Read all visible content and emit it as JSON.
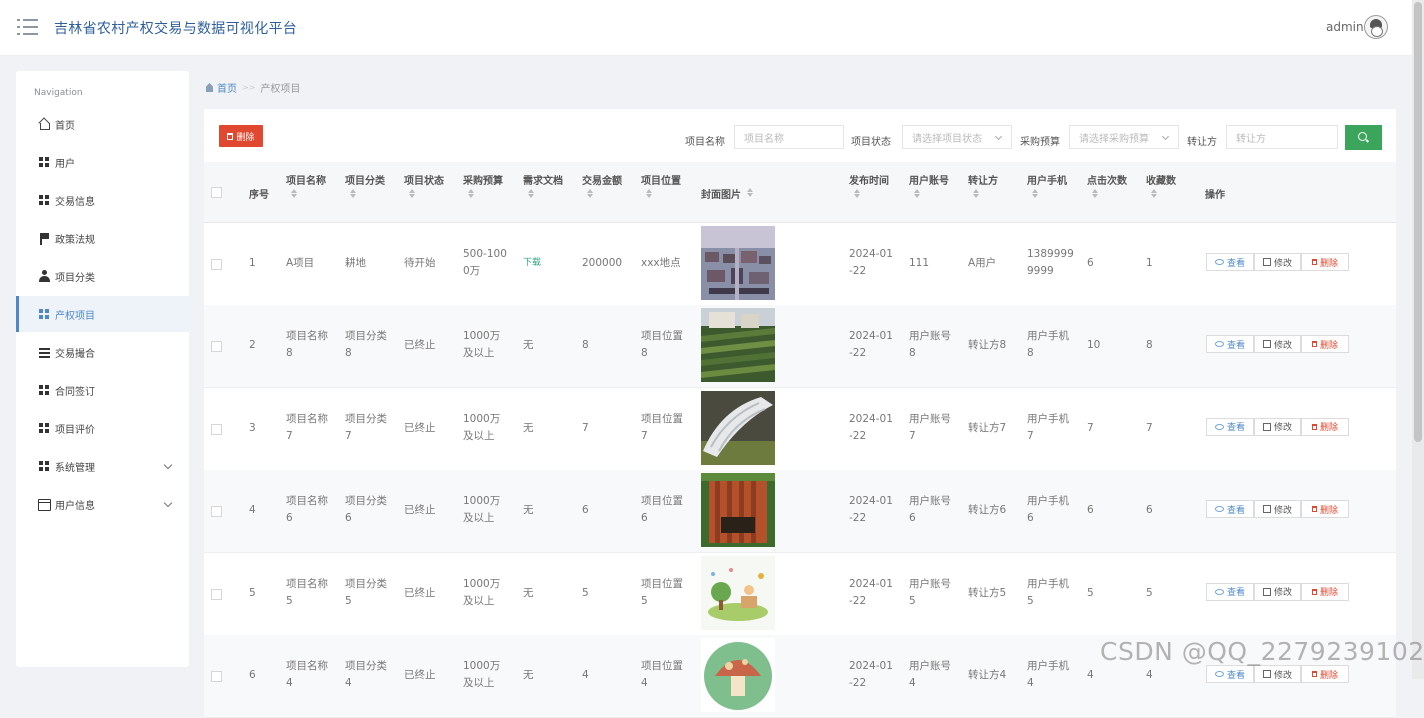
{
  "header": {
    "title": "吉林省农村产权交易与数据可视化平台",
    "user": "admin"
  },
  "sidebar": {
    "caption": "Navigation",
    "items": [
      {
        "label": "首页",
        "icon": "home-icon"
      },
      {
        "label": "用户",
        "icon": "grid-icon"
      },
      {
        "label": "交易信息",
        "icon": "grid-icon"
      },
      {
        "label": "政策法规",
        "icon": "flag-icon"
      },
      {
        "label": "项目分类",
        "icon": "user-icon"
      },
      {
        "label": "产权项目",
        "icon": "grid-icon",
        "active": true
      },
      {
        "label": "交易撮合",
        "icon": "list-icon"
      },
      {
        "label": "合同签订",
        "icon": "grid-icon"
      },
      {
        "label": "项目评价",
        "icon": "grid-icon"
      },
      {
        "label": "系统管理",
        "icon": "grid-icon",
        "expandable": true
      },
      {
        "label": "用户信息",
        "icon": "card-icon",
        "expandable": true
      }
    ]
  },
  "breadcrumb": {
    "home": "首页",
    "separator": ">>",
    "current": "产权项目"
  },
  "toolbar": {
    "delete_label": "删除",
    "filters": {
      "name_label": "项目名称",
      "name_placeholder": "项目名称",
      "status_label": "项目状态",
      "status_placeholder": "请选择项目状态",
      "budget_label": "采购预算",
      "budget_placeholder": "请选择采购预算",
      "transferor_label": "转让方",
      "transferor_placeholder": "转让方"
    }
  },
  "table": {
    "headers": {
      "index": "序号",
      "name": "项目名称",
      "category": "项目分类",
      "status": "项目状态",
      "budget": "采购预算",
      "doc": "需求文档",
      "amount": "交易金额",
      "location": "项目位置",
      "cover": "封面图片",
      "time": "发布时间",
      "account": "用户账号",
      "transferor": "转让方",
      "phone": "用户手机",
      "clicks": "点击次数",
      "favorites": "收藏数",
      "actions": "操作"
    },
    "action_labels": {
      "view": "查看",
      "edit": "修改",
      "delete": "删除"
    },
    "rows": [
      {
        "index": "1",
        "name": [
          "A项目"
        ],
        "category": [
          "耕地"
        ],
        "status": "待开始",
        "budget": [
          "500-100",
          "0万"
        ],
        "doc": "下载",
        "amount": "200000",
        "location": [
          "xxx地点"
        ],
        "cover": "town-aerial",
        "time": [
          "2024-01",
          "-22"
        ],
        "account": [
          "111"
        ],
        "transferor": "A用户",
        "phone": [
          "1389999",
          "9999"
        ],
        "clicks": "6",
        "favorites": "1"
      },
      {
        "index": "2",
        "name": [
          "项目名称",
          "8"
        ],
        "category": [
          "项目分类",
          "8"
        ],
        "status": "已终止",
        "budget": [
          "1000万",
          "及以上"
        ],
        "doc": "无",
        "amount": "8",
        "location": [
          "项目位置",
          "8"
        ],
        "cover": "vegetable-field",
        "time": [
          "2024-01",
          "-22"
        ],
        "account": [
          "用户账号",
          "8"
        ],
        "transferor": "转让方8",
        "phone": [
          "用户手机",
          "8"
        ],
        "clicks": "10",
        "favorites": "8"
      },
      {
        "index": "3",
        "name": [
          "项目名称",
          "7"
        ],
        "category": [
          "项目分类",
          "7"
        ],
        "status": "已终止",
        "budget": [
          "1000万",
          "及以上"
        ],
        "doc": "无",
        "amount": "7",
        "location": [
          "项目位置",
          "7"
        ],
        "cover": "greenhouse",
        "time": [
          "2024-01",
          "-22"
        ],
        "account": [
          "用户账号",
          "7"
        ],
        "transferor": "转让方7",
        "phone": [
          "用户手机",
          "7"
        ],
        "clicks": "7",
        "favorites": "7"
      },
      {
        "index": "4",
        "name": [
          "项目名称",
          "6"
        ],
        "category": [
          "项目分类",
          "6"
        ],
        "status": "已终止",
        "budget": [
          "1000万",
          "及以上"
        ],
        "doc": "无",
        "amount": "6",
        "location": [
          "项目位置",
          "6"
        ],
        "cover": "wooden-planter",
        "time": [
          "2024-01",
          "-22"
        ],
        "account": [
          "用户账号",
          "6"
        ],
        "transferor": "转让方6",
        "phone": [
          "用户手机",
          "6"
        ],
        "clicks": "6",
        "favorites": "6"
      },
      {
        "index": "5",
        "name": [
          "项目名称",
          "5"
        ],
        "category": [
          "项目分类",
          "5"
        ],
        "status": "已终止",
        "budget": [
          "1000万",
          "及以上"
        ],
        "doc": "无",
        "amount": "5",
        "location": [
          "项目位置",
          "5"
        ],
        "cover": "cartoon-garden",
        "time": [
          "2024-01",
          "-22"
        ],
        "account": [
          "用户账号",
          "5"
        ],
        "transferor": "转让方5",
        "phone": [
          "用户手机",
          "5"
        ],
        "clicks": "5",
        "favorites": "5"
      },
      {
        "index": "6",
        "name": [
          "项目名称",
          "4"
        ],
        "category": [
          "项目分类",
          "4"
        ],
        "status": "已终止",
        "budget": [
          "1000万",
          "及以上"
        ],
        "doc": "无",
        "amount": "4",
        "location": [
          "项目位置",
          "4"
        ],
        "cover": "mushroom-badge",
        "time": [
          "2024-01",
          "-22"
        ],
        "account": [
          "用户账号",
          "4"
        ],
        "transferor": "转让方4",
        "phone": [
          "用户手机",
          "4"
        ],
        "clicks": "4",
        "favorites": "4"
      }
    ]
  },
  "watermark": "CSDN @QQ_2279239102",
  "colors": {
    "accent": "#4e88c7",
    "danger": "#e0492f",
    "success": "#3ba55c",
    "title": "#2f5f9b"
  }
}
